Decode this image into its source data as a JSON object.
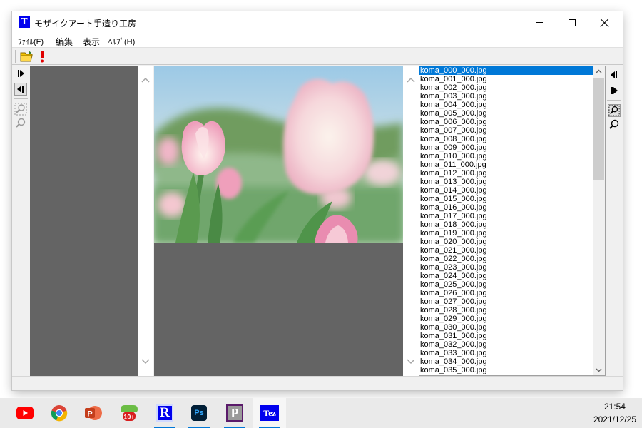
{
  "window": {
    "title": "モザイクアート手造り工房",
    "app_icon_letter": "T"
  },
  "menu": {
    "file": "ﾌｧｲﾙ(F)",
    "edit": "編集",
    "view": "表示",
    "help": "ﾍﾙﾌﾟ(H)"
  },
  "toolbar": {
    "icons": [
      "open-folder-icon",
      "exclamation-icon"
    ]
  },
  "file_list": {
    "selected_index": 0,
    "items": [
      "koma_000_000.jpg",
      "koma_001_000.jpg",
      "koma_002_000.jpg",
      "koma_003_000.jpg",
      "koma_004_000.jpg",
      "koma_005_000.jpg",
      "koma_006_000.jpg",
      "koma_007_000.jpg",
      "koma_008_000.jpg",
      "koma_009_000.jpg",
      "koma_010_000.jpg",
      "koma_011_000.jpg",
      "koma_012_000.jpg",
      "koma_013_000.jpg",
      "koma_014_000.jpg",
      "koma_015_000.jpg",
      "koma_016_000.jpg",
      "koma_017_000.jpg",
      "koma_018_000.jpg",
      "koma_019_000.jpg",
      "koma_020_000.jpg",
      "koma_021_000.jpg",
      "koma_022_000.jpg",
      "koma_023_000.jpg",
      "koma_024_000.jpg",
      "koma_025_000.jpg",
      "koma_026_000.jpg",
      "koma_027_000.jpg",
      "koma_028_000.jpg",
      "koma_029_000.jpg",
      "koma_030_000.jpg",
      "koma_031_000.jpg",
      "koma_032_000.jpg",
      "koma_033_000.jpg",
      "koma_034_000.jpg",
      "koma_035_000.jpg"
    ]
  },
  "taskbar": {
    "apps": [
      "youtube-icon",
      "chrome-icon",
      "powerpoint-icon",
      "clip-studio-icon",
      "r-app-icon",
      "photoshop-icon",
      "p-app-icon",
      "tez-app-icon"
    ],
    "r_app_letter": "R",
    "photoshop_label": "Ps",
    "p_app_letter": "P",
    "tez_app_label": "Tez",
    "clip_badge": "10+",
    "powerpoint_letter": "P",
    "time": "21:54",
    "date": "2021/12/25"
  },
  "colors": {
    "panel_gray": "#646464",
    "selection": "#0078d7",
    "app_icon_blue": "#0000ee"
  }
}
